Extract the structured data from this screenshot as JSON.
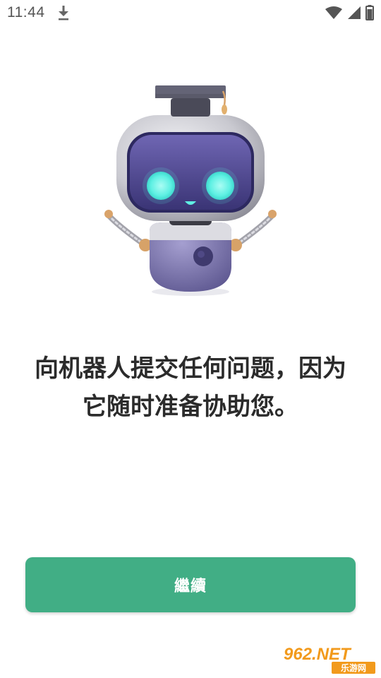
{
  "status_bar": {
    "time": "11:44",
    "icons": [
      "download-icon",
      "wifi-icon",
      "cellular-signal-icon",
      "battery-icon"
    ]
  },
  "illustration": {
    "subject": "robot-mascot-icon"
  },
  "message": {
    "line1": "向机器人提交任何问题，因为",
    "line2": "它随时准备协助您。"
  },
  "continue_button": {
    "label": "繼續",
    "color": "#41ae85"
  },
  "watermark": {
    "brand": "962.NET",
    "subtitle": "乐游网"
  }
}
